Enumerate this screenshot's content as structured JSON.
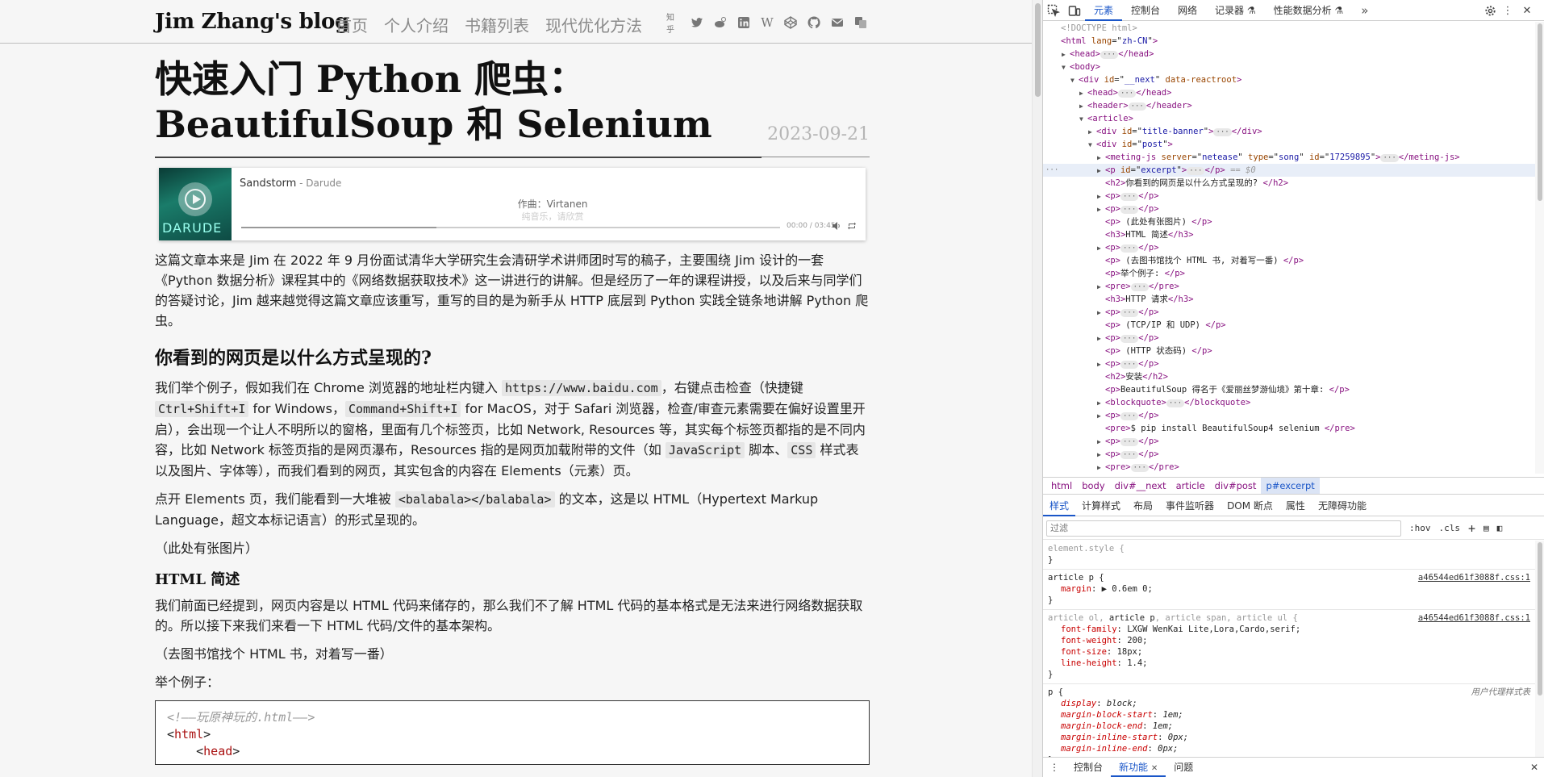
{
  "site": {
    "title": "Jim Zhang's blog",
    "nav": [
      "首页",
      "个人介绍",
      "书籍列表",
      "现代优化方法"
    ],
    "social_zhihu": "知乎"
  },
  "post": {
    "title": "快速入门 Python 爬虫：BeautifulSoup 和 Selenium",
    "date": "2023-09-21"
  },
  "player": {
    "cover_text": "DARUDE",
    "song": "Sandstorm",
    "artist_sep": " - Darude",
    "lyric_1": "作曲：Virtanen",
    "lyric_2": "纯音乐，请欣赏",
    "time": "00:00 / 03:45"
  },
  "article": {
    "p1": "这篇文章本来是 Jim 在 2022 年 9 月份面试清华大学研究生会清研学术讲师团时写的稿子，主要围绕 Jim 设计的一套《Python 数据分析》课程其中的《网络数据获取技术》这一讲进行的讲解。但是经历了一年的课程讲授，以及后来与同学们的答疑讨论，Jim 越来越觉得这篇文章应该重写，重写的目的是为新手从 HTTP 底层到 Python 实践全链条地讲解 Python 爬虫。",
    "h2_1": "你看到的网页是以什么方式呈现的?",
    "p2_a": "我们举个例子，假如我们在 Chrome 浏览器的地址栏内键入 ",
    "p2_code1": "https://www.baidu.com",
    "p2_b": "，右键点击检查（快捷键 ",
    "p2_code2": "Ctrl+Shift+I",
    "p2_c": " for Windows，",
    "p2_code3": "Command+Shift+I",
    "p2_d": " for MacOS，对于 Safari 浏览器，检查/审查元素需要在偏好设置里开启），会出现一个让人不明所以的窗格，里面有几个标签页，比如 Network, Resources 等，其实每个标签页都指的是不同内容，比如 Network 标签页指的是网页瀑布，Resources 指的是网页加载附带的文件（如 ",
    "p2_code4": "JavaScript",
    "p2_e": " 脚本、",
    "p2_code5": "CSS",
    "p2_f": " 样式表以及图片、字体等），而我们看到的网页，其实包含的内容在 Elements（元素）页。",
    "p3_a": "点开 Elements 页，我们能看到一大堆被 ",
    "p3_code": "<balabala></balabala>",
    "p3_b": " 的文本，这是以 HTML（Hypertext Markup Language，超文本标记语言）的形式呈现的。",
    "p4": "（此处有张图片）",
    "h3_1": "HTML 简述",
    "p5": "我们前面已经提到，网页内容是以 HTML 代码来储存的，那么我们不了解 HTML 代码的基本格式是无法来进行网络数据获取的。所以接下来我们来看一下 HTML 代码/文件的基本架构。",
    "p6": "（去图书馆找个 HTML 书，对着写一番）",
    "p7": "举个例子：",
    "code_l1": "<!——玩原神玩的.html——>",
    "code_l2": "<html>",
    "code_l3": "    <head>"
  },
  "devtools": {
    "tabs": [
      "元素",
      "控制台",
      "网络",
      "记录器 ⚗",
      "性能数据分析 ⚗"
    ],
    "more": "»",
    "dom": [
      {
        "indent": 0,
        "tw": "",
        "html": "<!DOCTYPE html>",
        "kind": "doctype"
      },
      {
        "indent": 0,
        "tw": "",
        "tag": "html",
        "attrs": [
          [
            "lang",
            "zh-CN"
          ]
        ],
        "close": ""
      },
      {
        "indent": 1,
        "tw": "▶",
        "tag": "head",
        "collapsed": true,
        "close": "head"
      },
      {
        "indent": 1,
        "tw": "▼",
        "tag": "body",
        "close": ""
      },
      {
        "indent": 2,
        "tw": "▼",
        "tag": "div",
        "attrs": [
          [
            "id",
            "__next"
          ],
          [
            "data-reactroot",
            ""
          ]
        ],
        "close": ""
      },
      {
        "indent": 3,
        "tw": "▶",
        "tag": "head",
        "collapsed": true,
        "close": "head"
      },
      {
        "indent": 3,
        "tw": "▶",
        "tag": "header",
        "collapsed": true,
        "close": "header"
      },
      {
        "indent": 3,
        "tw": "▼",
        "tag": "article",
        "close": ""
      },
      {
        "indent": 4,
        "tw": "▶",
        "tag": "div",
        "attrs": [
          [
            "id",
            "title-banner"
          ]
        ],
        "collapsed": true,
        "close": "div"
      },
      {
        "indent": 4,
        "tw": "▼",
        "tag": "div",
        "attrs": [
          [
            "id",
            "post"
          ]
        ],
        "close": ""
      },
      {
        "indent": 5,
        "tw": "▶",
        "tag": "meting-js",
        "attrs": [
          [
            "server",
            "netease"
          ],
          [
            "type",
            "song"
          ],
          [
            "id",
            "17259895"
          ]
        ],
        "collapsed": true,
        "close": "meting-js"
      },
      {
        "indent": 5,
        "tw": "▶",
        "tag": "p",
        "attrs": [
          [
            "id",
            "excerpt"
          ]
        ],
        "collapsed": true,
        "close": "p",
        "selected": true,
        "suffix": " == $0"
      },
      {
        "indent": 5,
        "tw": "",
        "tag": "h2",
        "text": "你看到的网页是以什么方式呈现的? ",
        "close": "h2"
      },
      {
        "indent": 5,
        "tw": "▶",
        "tag": "p",
        "collapsed": true,
        "close": "p"
      },
      {
        "indent": 5,
        "tw": "▶",
        "tag": "p",
        "collapsed": true,
        "close": "p"
      },
      {
        "indent": 5,
        "tw": "",
        "tag": "p",
        "text": " (此处有张图片) ",
        "close": "p"
      },
      {
        "indent": 5,
        "tw": "",
        "tag": "h3",
        "text": "HTML 简述",
        "close": "h3"
      },
      {
        "indent": 5,
        "tw": "▶",
        "tag": "p",
        "collapsed": true,
        "close": "p"
      },
      {
        "indent": 5,
        "tw": "",
        "tag": "p",
        "text": " (去图书馆找个 HTML 书, 对着写一番) ",
        "close": "p"
      },
      {
        "indent": 5,
        "tw": "",
        "tag": "p",
        "text": "举个例子: ",
        "close": "p"
      },
      {
        "indent": 5,
        "tw": "▶",
        "tag": "pre",
        "collapsed": true,
        "close": "pre"
      },
      {
        "indent": 5,
        "tw": "",
        "tag": "h3",
        "text": "HTTP 请求",
        "close": "h3"
      },
      {
        "indent": 5,
        "tw": "▶",
        "tag": "p",
        "collapsed": true,
        "close": "p"
      },
      {
        "indent": 5,
        "tw": "",
        "tag": "p",
        "text": " (TCP/IP 和 UDP) ",
        "close": "p"
      },
      {
        "indent": 5,
        "tw": "▶",
        "tag": "p",
        "collapsed": true,
        "close": "p"
      },
      {
        "indent": 5,
        "tw": "",
        "tag": "p",
        "text": " (HTTP 状态码) ",
        "close": "p"
      },
      {
        "indent": 5,
        "tw": "▶",
        "tag": "p",
        "collapsed": true,
        "close": "p"
      },
      {
        "indent": 5,
        "tw": "",
        "tag": "h2",
        "text": "安装",
        "close": "h2"
      },
      {
        "indent": 5,
        "tw": "",
        "tag": "p",
        "text": "BeautifulSoup 得名于《爱丽丝梦游仙境》第十章: ",
        "close": "p"
      },
      {
        "indent": 5,
        "tw": "▶",
        "tag": "blockquote",
        "collapsed": true,
        "close": "blockquote"
      },
      {
        "indent": 5,
        "tw": "▶",
        "tag": "p",
        "collapsed": true,
        "close": "p"
      },
      {
        "indent": 5,
        "tw": "",
        "tag": "pre",
        "text": "$ pip install BeautifulSoup4 selenium ",
        "close": "pre"
      },
      {
        "indent": 5,
        "tw": "▶",
        "tag": "p",
        "collapsed": true,
        "close": "p"
      },
      {
        "indent": 5,
        "tw": "▶",
        "tag": "p",
        "collapsed": true,
        "close": "p"
      },
      {
        "indent": 5,
        "tw": "▶",
        "tag": "pre",
        "collapsed": true,
        "close": "pre"
      }
    ],
    "breadcrumbs": [
      "html",
      "body",
      "div#__next",
      "article",
      "div#post",
      "p#excerpt"
    ],
    "style_tabs": [
      "样式",
      "计算样式",
      "布局",
      "事件监听器",
      "DOM 断点",
      "属性",
      "无障碍功能"
    ],
    "filter_placeholder": "过滤",
    "hov": ":hov",
    "cls": ".cls",
    "rules": [
      {
        "selector": "element.style {",
        "dim": true,
        "source": "",
        "decls": []
      },
      {
        "selector": "article p {",
        "source": "a46544ed61f3088f.css:1",
        "decls": [
          [
            "margin",
            "▶ 0.6em 0;"
          ]
        ]
      },
      {
        "selector_parts": [
          [
            "article ol, ",
            true
          ],
          [
            "article p",
            false
          ],
          [
            ", article span, article ul {",
            true
          ]
        ],
        "source": "a46544ed61f3088f.css:1",
        "decls": [
          [
            "font-family",
            "LXGW WenKai Lite,Lora,Cardo,serif;"
          ],
          [
            "font-weight",
            "200;"
          ],
          [
            "font-size",
            "18px;"
          ],
          [
            "line-height",
            "1.4;"
          ]
        ]
      },
      {
        "selector": "p {",
        "source": "用户代理样式表",
        "ua": true,
        "decls": [
          [
            "display",
            "block;"
          ],
          [
            "margin-block-start",
            "1em;"
          ],
          [
            "margin-block-end",
            "1em;"
          ],
          [
            "margin-inline-start",
            "0px;"
          ],
          [
            "margin-inline-end",
            "0px;"
          ]
        ]
      }
    ],
    "drawer_tabs": [
      "控制台",
      "新功能",
      "问题"
    ]
  }
}
